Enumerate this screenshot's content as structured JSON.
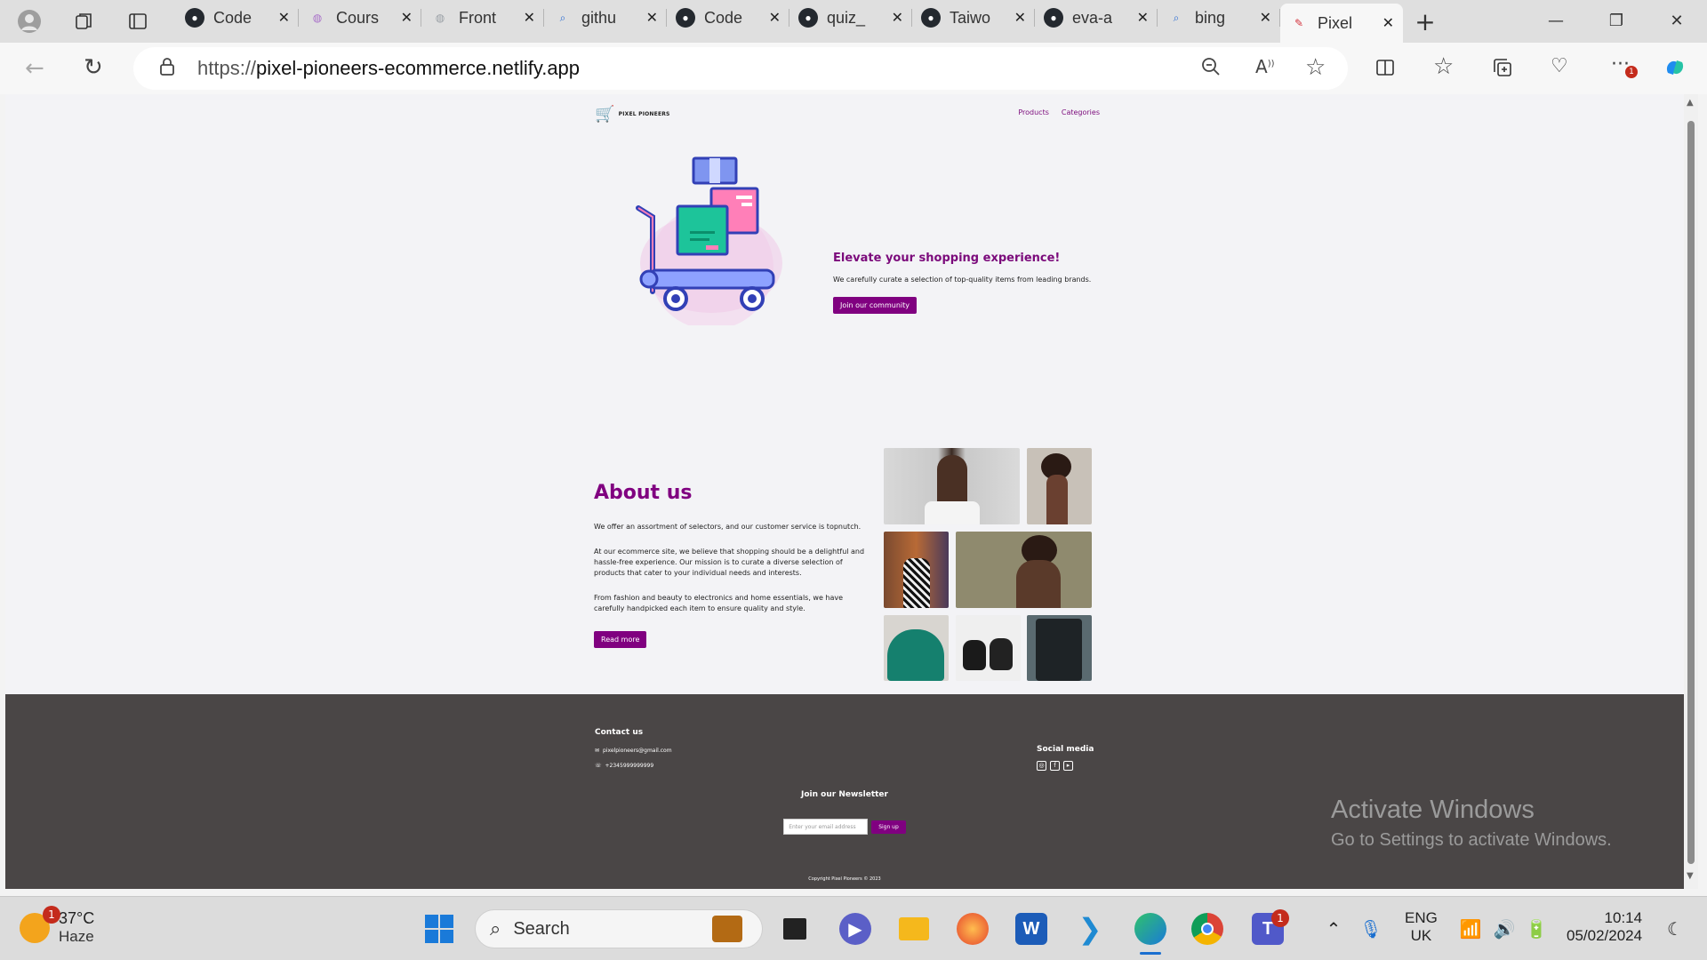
{
  "browser": {
    "tabs": [
      {
        "label": "Code",
        "icon": "github-icon",
        "color": "#24292f"
      },
      {
        "label": "Cours",
        "icon": "course-icon",
        "color": "#a970c9"
      },
      {
        "label": "Front",
        "icon": "page-icon",
        "color": "#9aa0a6"
      },
      {
        "label": "githu",
        "icon": "search-icon",
        "color": "#2b6cd4"
      },
      {
        "label": "Code",
        "icon": "github-icon",
        "color": "#24292f"
      },
      {
        "label": "quiz_",
        "icon": "github-icon",
        "color": "#24292f"
      },
      {
        "label": "Taiwo",
        "icon": "github-icon",
        "color": "#24292f"
      },
      {
        "label": "eva-a",
        "icon": "github-icon",
        "color": "#24292f"
      },
      {
        "label": "bing",
        "icon": "search-icon",
        "color": "#2b6cd4"
      },
      {
        "label": "Pixel",
        "icon": "feather-icon",
        "color": "#d4343f"
      }
    ],
    "url_prefix": "https://",
    "url_host": "pixel-pioneers-ecommerce.netlify.app"
  },
  "site": {
    "brand": "PIXEL PIONEERS",
    "nav": {
      "products": "Products",
      "categories": "Categories"
    },
    "hero": {
      "title": "Elevate your shopping experience!",
      "subtitle": "We carefully curate a selection of top-quality items from leading brands.",
      "cta": "Join our community"
    },
    "about": {
      "title": "About us",
      "p1": "We offer an assortment of selectors, and our customer service is topnutch.",
      "p2": "At our ecommerce site, we believe that shopping should be a delightful and hassle-free experience. Our mission is to curate a diverse selection of products that cater to your individual needs and interests.",
      "p3": "From fashion and beauty to electronics and home essentials, we have carefully handpicked each item to ensure quality and style.",
      "cta": "Read more"
    },
    "footer": {
      "contact_title": "Contact us",
      "email": "pixelpioneers@gmail.com",
      "phone": "+2345999999999",
      "social_title": "Social media",
      "newsletter_title": "Join our Newsletter",
      "email_placeholder": "Enter your email address",
      "signup": "Sign up",
      "copyright": "Copyright Pixel Pioneers © 2023"
    },
    "accent": "#800080",
    "footer_bg": "#4a4646"
  },
  "watermark": {
    "line1": "Activate Windows",
    "line2": "Go to Settings to activate Windows."
  },
  "taskbar": {
    "temperature": "37°C",
    "condition": "Haze",
    "weather_badge": "1",
    "search_label": "Search",
    "teams_badge": "1",
    "lang": "ENG",
    "region": "UK",
    "time": "10:14",
    "date": "05/02/2024"
  }
}
